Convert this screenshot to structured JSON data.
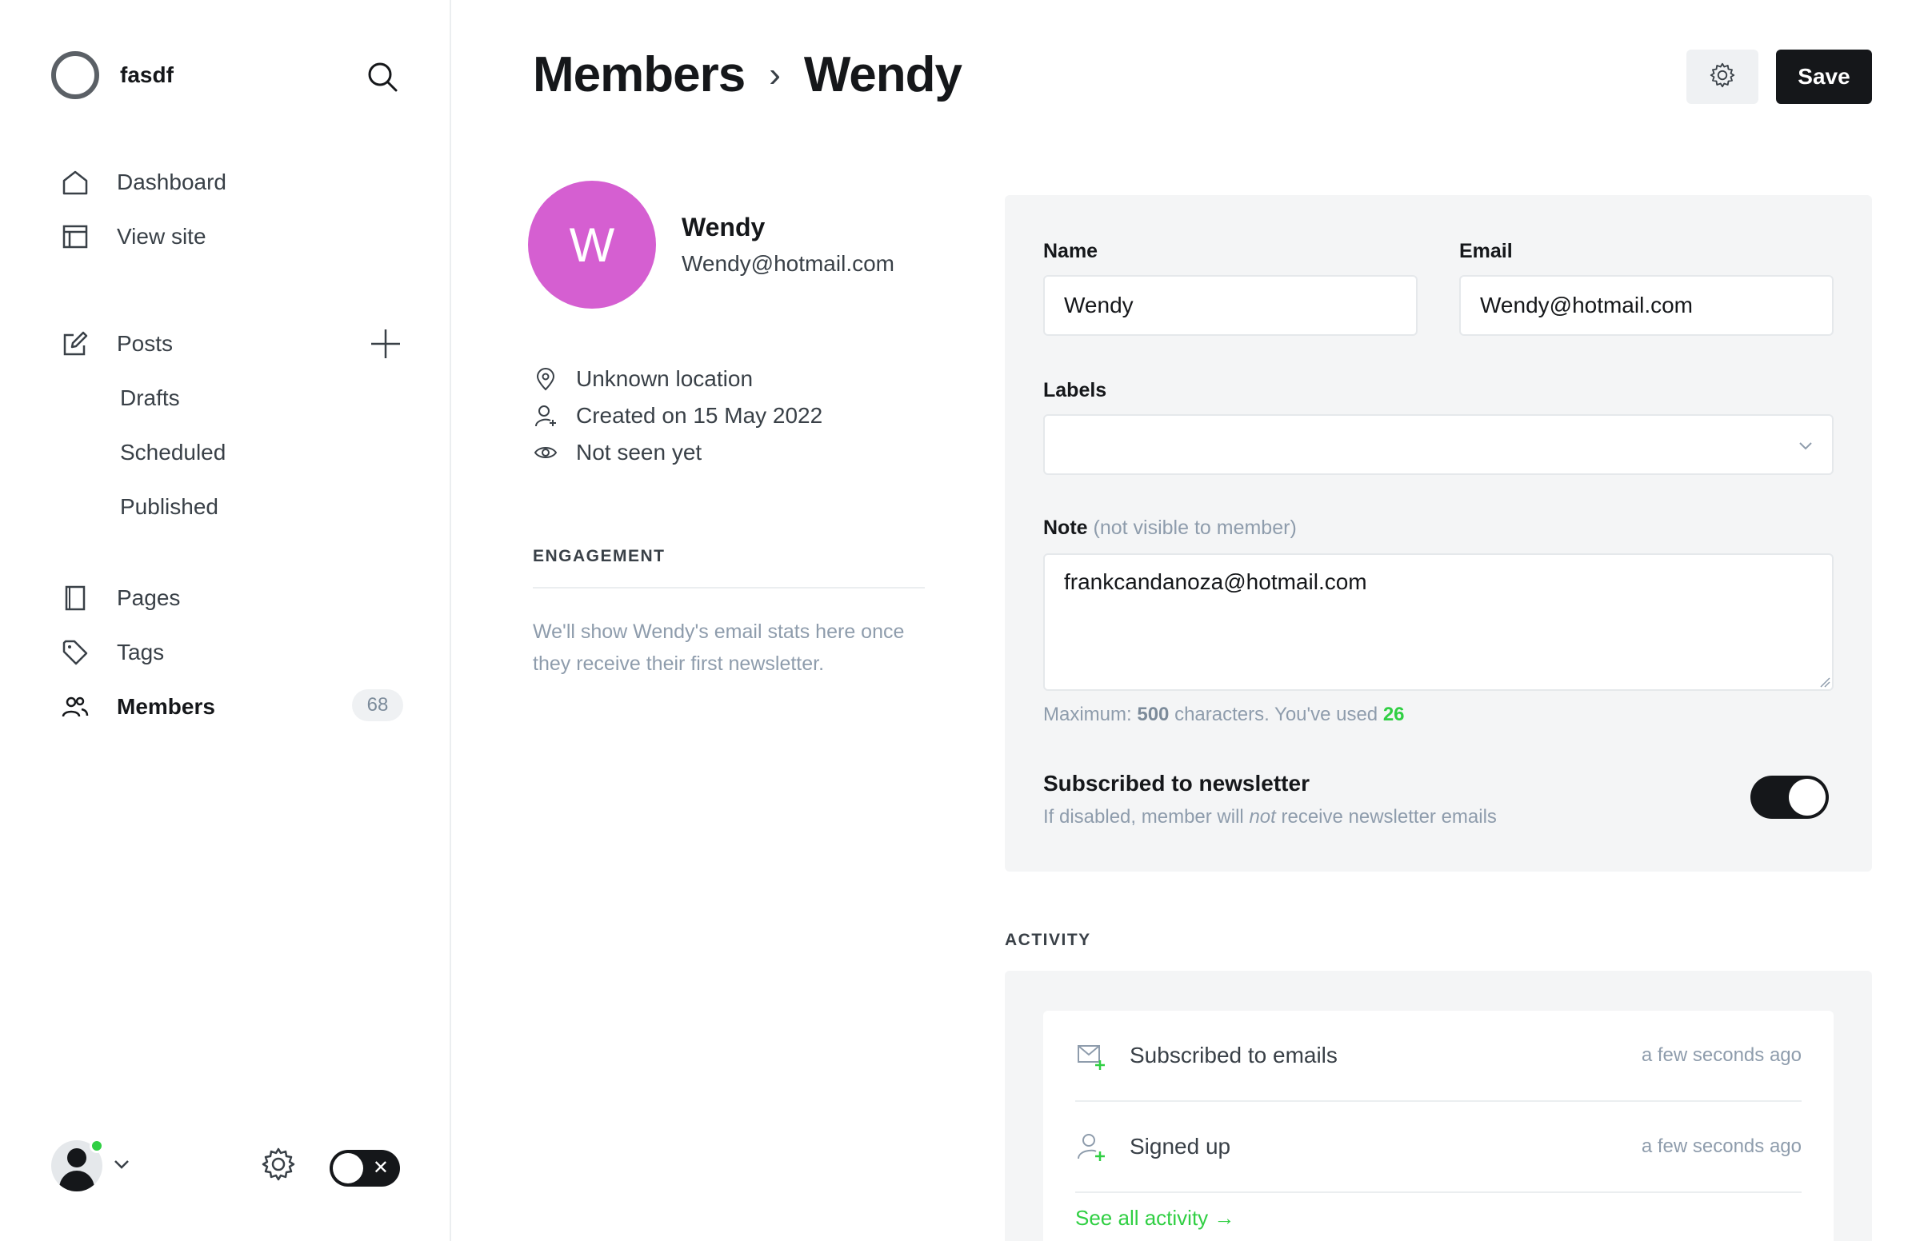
{
  "sidebar": {
    "site_name": "fasdf",
    "nav": {
      "dashboard": "Dashboard",
      "view_site": "View site",
      "posts": "Posts",
      "drafts": "Drafts",
      "scheduled": "Scheduled",
      "published": "Published",
      "pages": "Pages",
      "tags": "Tags",
      "members": "Members",
      "members_count": "68"
    }
  },
  "header": {
    "crumb_parent": "Members",
    "crumb_separator": "›",
    "crumb_current": "Wendy",
    "save_label": "Save"
  },
  "member": {
    "avatar_initial": "W",
    "name": "Wendy",
    "email": "Wendy@hotmail.com",
    "location": "Unknown location",
    "created": "Created on 15 May 2022",
    "last_seen": "Not seen yet",
    "avatar_color": "#d55fd1"
  },
  "engagement": {
    "title": "ENGAGEMENT",
    "text": "We'll show Wendy's email stats here once they receive their first newsletter."
  },
  "form": {
    "name_label": "Name",
    "name_value": "Wendy",
    "email_label": "Email",
    "email_value": "Wendy@hotmail.com",
    "labels_label": "Labels",
    "note_label": "Note",
    "note_hint": "(not visible to member)",
    "note_value": "frankcandanoza@hotmail.com",
    "char_prefix": "Maximum:",
    "char_max": "500",
    "char_middle": "characters. You've used",
    "char_used": "26",
    "newsletter_title": "Subscribed to newsletter",
    "newsletter_desc_pre": "If disabled, member will",
    "newsletter_desc_em": "not",
    "newsletter_desc_post": "receive newsletter emails",
    "newsletter_enabled": true
  },
  "activity": {
    "title": "ACTIVITY",
    "items": [
      {
        "label": "Subscribed to emails",
        "time": "a few seconds ago",
        "icon": "email-subscribe-icon"
      },
      {
        "label": "Signed up",
        "time": "a few seconds ago",
        "icon": "user-add-icon"
      }
    ],
    "see_all": "See all activity →"
  },
  "colors": {
    "accent": "#30cf43",
    "dark": "#15171a",
    "panel_bg": "#f4f5f6",
    "muted_text": "#8e9cac"
  }
}
